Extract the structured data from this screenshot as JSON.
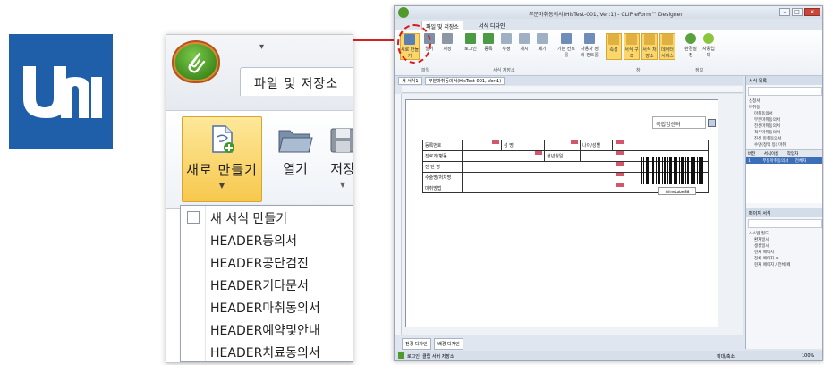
{
  "colors": {
    "logo_bg": "#1f5ea8",
    "highlight": "#f7c84e",
    "connector": "#d62020",
    "app_button": "#3d8a1c"
  },
  "zoom": {
    "quick_access_arrow": "▾",
    "tab_file": "파일 및 저장소",
    "buttons": {
      "new_label": "새로 만들기",
      "open_label": "열기",
      "save_label": "저장"
    },
    "menu_items": [
      "새 서식 만들기",
      "HEADER동의서",
      "HEADER공단검진",
      "HEADER기타문서",
      "HEADER마취동의서",
      "HEADER예약및안내",
      "HEADER치료동의서"
    ]
  },
  "window": {
    "title": "부분마취동의서(HisTest-001, Ver:1) - CLIP eForm™ Designer",
    "tabs": [
      "파일 및 저장소",
      "서식 디자인"
    ],
    "ribbon_buttons": [
      "새로 만들기",
      "열기",
      "저장",
      "로그인",
      "등록",
      "수정",
      "게시",
      "폐기",
      "기본 컨트롤",
      "사용자 정의 컨트롤",
      "속성",
      "서식 구조",
      "서식 저장소",
      "데이터 서비스",
      "환경설정",
      "자동업데"
    ],
    "ribbon_groups": [
      "파일",
      "서식 저장소",
      "창",
      "정보"
    ],
    "doc_tabs": [
      "새 서식1",
      "부분마취동의서(HisTest-001, Ver:1)"
    ],
    "form": {
      "hospital": "국립암센터",
      "rows": [
        [
          "등록번호",
          "성 명",
          "나이/성별"
        ],
        [
          "진료과/병동",
          "생년월일"
        ],
        [
          "진 단 명"
        ],
        [
          "수술명/처치명"
        ],
        [
          "마취방법"
        ]
      ],
      "barcode_caption": "InlineLabel88"
    },
    "side_panel": {
      "title": "서식 목록",
      "tree": [
        "신청서",
        "마취동",
        "마취동의서",
        "부분마취동의서",
        "전신마취동의서",
        "척추마취동의서",
        "진신 마취동의서",
        "수면(정맥 등) 마취"
      ],
      "table_headers": [
        "버전",
        "서식이름",
        "작업자"
      ],
      "table_row": [
        "1",
        "부분마취동의서",
        "전체자"
      ],
      "panel2_title": "페이지 서식",
      "panel2_tree": [
        "시스템 필드",
        "환자일시",
        "생성일시",
        "현재 페이지",
        "전체 페이지 수",
        "현재 페이지 / 전체 페"
      ]
    },
    "bottom_tabs": [
      "전경 디자인",
      "배경 디자인"
    ],
    "status_left": "로그인: 클립 서버 저장소",
    "status_right": "확대/축소",
    "zoom_pct": "100%"
  }
}
